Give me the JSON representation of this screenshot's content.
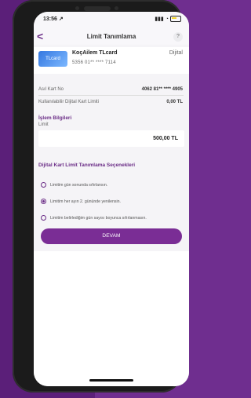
{
  "status_bar": {
    "time": "13:56 ↗",
    "signal": "▮▮▮",
    "wifi": "◔"
  },
  "nav": {
    "back_label": "<",
    "title": "Limit Tanımlama",
    "help_label": "?"
  },
  "card": {
    "image_text": "TLcard",
    "name": "KoçAilem TLcard",
    "type": "Dijital",
    "number": "5356 01** **** 7114"
  },
  "info": {
    "ask_no_label": "Asıl Kart No",
    "ask_no_value": "4062 81** **** 4905",
    "available_label": "Kullanılabilir Dijital Kart Limiti",
    "available_value": "0,00 TL"
  },
  "transaction": {
    "section_title": "İşlem Bilgileri",
    "limit_label": "Limit",
    "limit_value": "500,00 TL"
  },
  "options_section": {
    "title": "Dijital Kart Limit Tanımlama Seçenekleri",
    "items": [
      "Limitim gün sonunda sıfırlansın.",
      "Limitim her ayın 2. gününde yenilensin.",
      "Limitim belirlediğim gün sayısı boyunca sıfırlanmasın."
    ],
    "selected_index": 1
  },
  "actions": {
    "continue_label": "DEVAM"
  },
  "colors": {
    "accent": "#7a2d95",
    "background_purple": "#6f2e8f"
  }
}
